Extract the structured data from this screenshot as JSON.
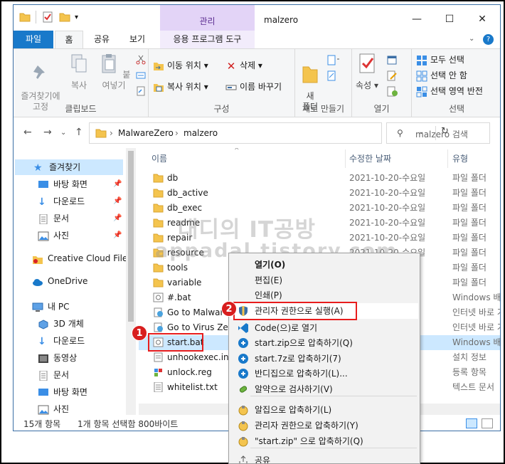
{
  "window": {
    "title": "malzero",
    "manage_label": "관리",
    "minimize": "—",
    "maximize": "☐",
    "close": "✕"
  },
  "tabs": {
    "file": "파일",
    "home": "홈",
    "share": "공유",
    "view": "보기",
    "app_tools": "응용 프로그램 도구"
  },
  "ribbon": {
    "clipboard": {
      "label": "클립보드",
      "pin_quick_access": "즐겨찾기에\n고정",
      "copy": "복사",
      "paste": "붙여넣기"
    },
    "organize": {
      "label": "구성",
      "move_to": "이동 위치",
      "copy_to": "복사 위치",
      "delete": "삭제",
      "rename": "이름 바꾸기"
    },
    "new": {
      "label": "새로 만들기",
      "new_folder": "새\n폴더"
    },
    "open": {
      "label": "열기",
      "properties": "속성"
    },
    "select": {
      "label": "선택",
      "select_all": "모두 선택",
      "select_none": "선택 안 함",
      "invert_selection": "선택 영역 반전"
    }
  },
  "address": {
    "crumbs": [
      "MalwareZero",
      "malzero"
    ],
    "search_placeholder": "malzero 검색"
  },
  "nav": {
    "items": [
      {
        "label": "즐겨찾기",
        "icon": "star-icon"
      },
      {
        "label": "바탕 화면",
        "icon": "desktop-icon",
        "pinned": true
      },
      {
        "label": "다운로드",
        "icon": "download-icon",
        "pinned": true
      },
      {
        "label": "문서",
        "icon": "document-icon",
        "pinned": true
      },
      {
        "label": "사진",
        "icon": "picture-icon",
        "pinned": true
      },
      {
        "label": "Creative Cloud Files",
        "icon": "creative-cloud-icon"
      },
      {
        "label": "OneDrive",
        "icon": "onedrive-icon"
      },
      {
        "label": "내 PC",
        "icon": "pc-icon"
      },
      {
        "label": "3D 개체",
        "icon": "3d-objects-icon"
      },
      {
        "label": "다운로드",
        "icon": "download-icon"
      },
      {
        "label": "동영상",
        "icon": "video-icon"
      },
      {
        "label": "문서",
        "icon": "document-icon"
      },
      {
        "label": "바탕 화면",
        "icon": "desktop-icon"
      },
      {
        "label": "사진",
        "icon": "picture-icon"
      }
    ]
  },
  "columns": {
    "name": "이름",
    "date": "수정한 날짜",
    "type": "유형"
  },
  "files": [
    {
      "name": "db",
      "date": "2021-10-20-수요일",
      "type": "파일 폴더",
      "kind": "folder"
    },
    {
      "name": "db_active",
      "date": "2021-10-20-수요일",
      "type": "파일 폴더",
      "kind": "folder"
    },
    {
      "name": "db_exec",
      "date": "2021-10-20-수요일",
      "type": "파일 폴더",
      "kind": "folder"
    },
    {
      "name": "readme",
      "date": "2021-10-20-수요일",
      "type": "파일 폴더",
      "kind": "folder"
    },
    {
      "name": "repair",
      "date": "2021-10-20-수요일",
      "type": "파일 폴더",
      "kind": "folder"
    },
    {
      "name": "resource",
      "date": "2021-10-20-수요일",
      "type": "파일 폴더",
      "kind": "folder"
    },
    {
      "name": "tools",
      "date": "",
      "type": "파일 폴더",
      "kind": "folder"
    },
    {
      "name": "variable",
      "date": "",
      "type": "파일 폴더",
      "kind": "folder"
    },
    {
      "name": "#.bat",
      "date": "",
      "type": "Windows 배치 파",
      "kind": "bat"
    },
    {
      "name": "Go to Malware",
      "date": "",
      "type": "인터넷 바로 가기",
      "kind": "url"
    },
    {
      "name": "Go to Virus Zero",
      "date": "",
      "type": "인터넷 바로 가기",
      "kind": "url"
    },
    {
      "name": "start.bat",
      "date": "",
      "type": "Windows 배치 파",
      "kind": "bat"
    },
    {
      "name": "unhookexec.inf",
      "date": "",
      "type": "설치 정보",
      "kind": "inf"
    },
    {
      "name": "unlock.reg",
      "date": "",
      "type": "등록 항목",
      "kind": "reg"
    },
    {
      "name": "whitelist.txt",
      "date": "",
      "type": "텍스트 문서",
      "kind": "txt"
    }
  ],
  "status": {
    "count": "15개 항목",
    "selected": "1개 항목 선택함 800바이트"
  },
  "context_menu": {
    "items": [
      {
        "label": "열기(O)",
        "bold": true,
        "icon": ""
      },
      {
        "label": "편집(E)",
        "icon": ""
      },
      {
        "label": "인쇄(P)",
        "icon": ""
      },
      {
        "label": "관리자 권한으로 실행(A)",
        "icon": "shield-icon"
      },
      {
        "label": "Code(으)로 열기",
        "icon": "vscode-icon"
      },
      {
        "label": "start.zip으로 압축하기(Q)",
        "icon": "bandizip-icon"
      },
      {
        "label": "start.7z로 압축하기(7)",
        "icon": "bandizip-icon"
      },
      {
        "label": "반디집으로 압축하기(L)...",
        "icon": "bandizip-icon"
      },
      {
        "label": "알약으로 검사하기(V)",
        "icon": "alyac-icon"
      },
      {
        "label": "알집으로 압축하기(L)",
        "icon": "alzip-icon"
      },
      {
        "label": "관리자 권한으로 압축하기(Y)",
        "icon": "alzip-icon"
      },
      {
        "label": "\"start.zip\" 으로 압축하기(Q)",
        "icon": "alzip-icon"
      },
      {
        "label": "공유",
        "icon": "share-icon"
      }
    ]
  },
  "annotations": {
    "badge1": "1",
    "badge2": "2"
  },
  "watermark": {
    "line1": "대디의 IT공방",
    "line2": "appadal.tistory.com"
  },
  "colors": {
    "accent": "#1979ca",
    "selection": "#cce8ff",
    "manage_band": "#e3d4f7",
    "annotation_red": "#e81d1d",
    "folder": "#f4c44e"
  }
}
